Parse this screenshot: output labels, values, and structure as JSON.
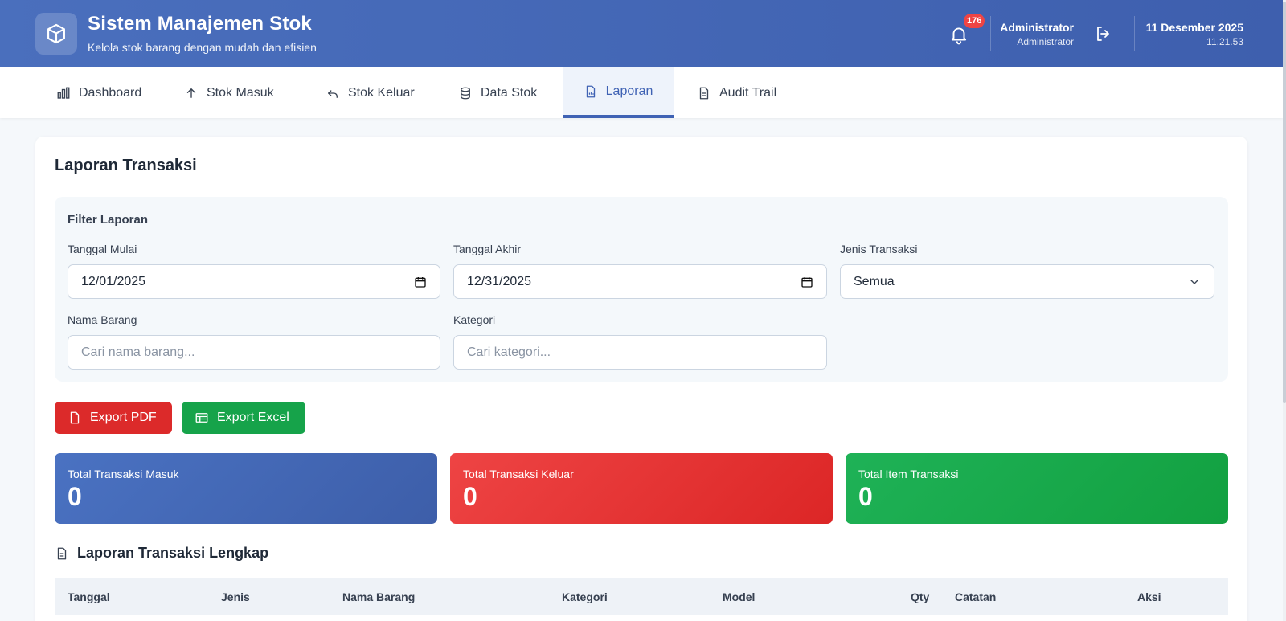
{
  "header": {
    "title": "Sistem Manajemen Stok",
    "subtitle": "Kelola stok barang dengan mudah dan efisien",
    "notification_count": "176",
    "user_name": "Administrator",
    "user_role": "Administrator",
    "date": "11 Desember 2025",
    "time": "11.21.53"
  },
  "nav": {
    "tabs": [
      {
        "label": "Dashboard",
        "icon": "bar-chart-icon"
      },
      {
        "label": "Stok Masuk",
        "icon": "arrow-up-icon"
      },
      {
        "label": "Stok Keluar",
        "icon": "undo-arrow-icon"
      },
      {
        "label": "Data Stok",
        "icon": "database-icon"
      },
      {
        "label": "Laporan",
        "icon": "report-icon",
        "active": true
      },
      {
        "label": "Audit Trail",
        "icon": "document-icon"
      }
    ]
  },
  "card": {
    "title": "Laporan Transaksi"
  },
  "filter": {
    "title": "Filter Laporan",
    "start_date_label": "Tanggal Mulai",
    "start_date_value": "12/01/2025",
    "end_date_label": "Tanggal Akhir",
    "end_date_value": "12/31/2025",
    "type_label": "Jenis Transaksi",
    "type_value": "Semua",
    "item_name_label": "Nama Barang",
    "item_name_placeholder": "Cari nama barang...",
    "category_label": "Kategori",
    "category_placeholder": "Cari kategori..."
  },
  "actions": {
    "export_pdf": "Export PDF",
    "export_excel": "Export Excel"
  },
  "stats": {
    "in_label": "Total Transaksi Masuk",
    "in_value": "0",
    "out_label": "Total Transaksi Keluar",
    "out_value": "0",
    "items_label": "Total Item Transaksi",
    "items_value": "0"
  },
  "report": {
    "title": "Laporan Transaksi Lengkap",
    "columns": [
      "Tanggal",
      "Jenis",
      "Nama Barang",
      "Kategori",
      "Model",
      "Qty",
      "Catatan",
      "Aksi"
    ]
  },
  "colors": {
    "primary": "#3f62b4",
    "danger": "#dc2a2a",
    "success": "#16a34a"
  }
}
